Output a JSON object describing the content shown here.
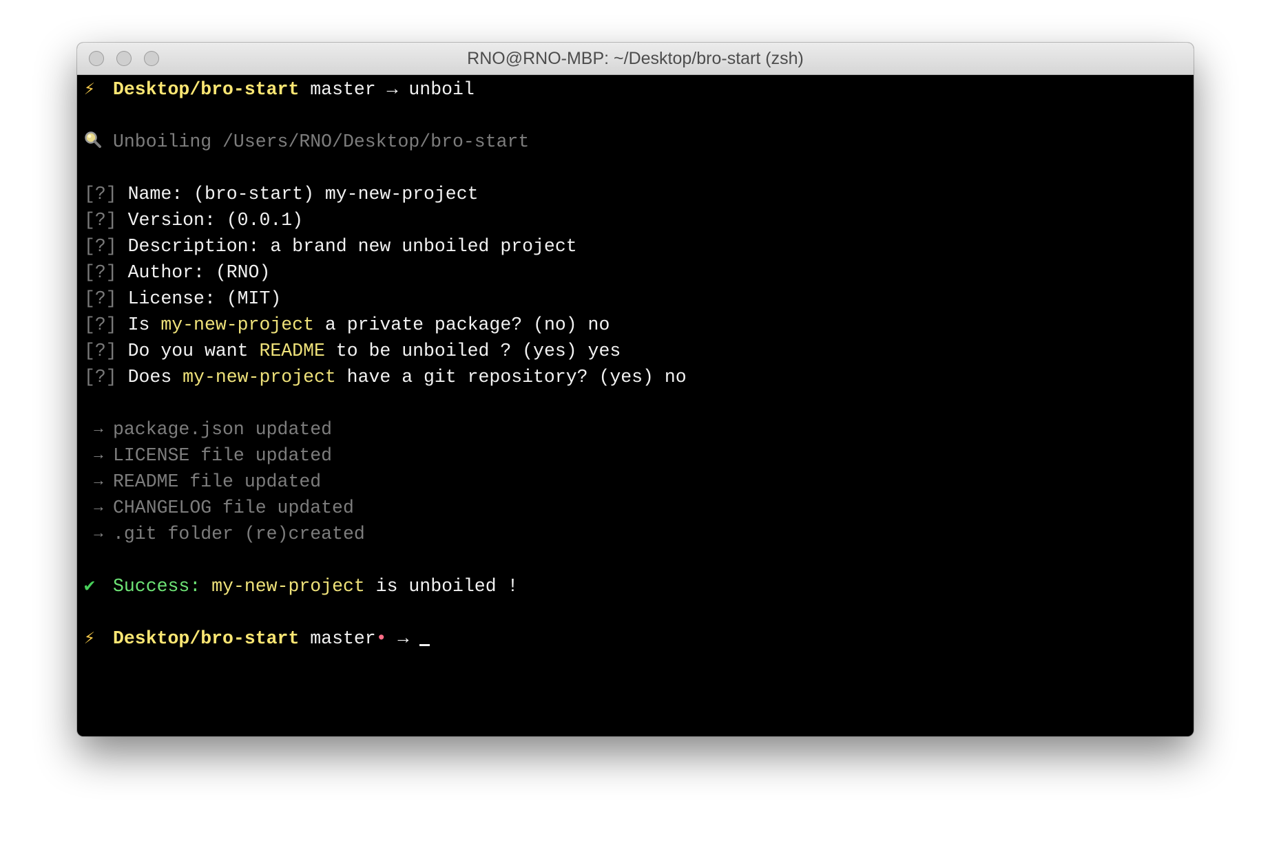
{
  "window": {
    "title": "RNO@RNO-MBP: ~/Desktop/bro-start (zsh)"
  },
  "colors": {
    "terminal_bg": "#000000",
    "path_yellow": "#fbe673",
    "highlight_yellow": "#efe27a",
    "dim_gray": "#7d7d7d",
    "success_green": "#6ee476",
    "dirty_dot_pink": "#ff6e87"
  },
  "prompt1": {
    "icon": "lightning-bolt-icon",
    "bolt": "⚡",
    "path": "Desktop/bro-start",
    "branch": "master",
    "arrow": "→",
    "command": "unboil"
  },
  "unboiling": {
    "icon": "magnifying-glass-icon",
    "text": "Unboiling /Users/RNO/Desktop/bro-start"
  },
  "questions": [
    {
      "marker": "[?]",
      "parts": [
        {
          "text": "Name: (bro-start) my-new-project",
          "hl": false
        }
      ]
    },
    {
      "marker": "[?]",
      "parts": [
        {
          "text": "Version: (0.0.1)",
          "hl": false
        }
      ]
    },
    {
      "marker": "[?]",
      "parts": [
        {
          "text": "Description: a brand new unboiled project",
          "hl": false
        }
      ]
    },
    {
      "marker": "[?]",
      "parts": [
        {
          "text": "Author: (RNO)",
          "hl": false
        }
      ]
    },
    {
      "marker": "[?]",
      "parts": [
        {
          "text": "License: (MIT)",
          "hl": false
        }
      ]
    },
    {
      "marker": "[?]",
      "parts": [
        {
          "text": "Is ",
          "hl": false
        },
        {
          "text": "my-new-project",
          "hl": true
        },
        {
          "text": " a private package? (no) no",
          "hl": false
        }
      ]
    },
    {
      "marker": "[?]",
      "parts": [
        {
          "text": "Do you want ",
          "hl": false
        },
        {
          "text": "README",
          "hl": true
        },
        {
          "text": " to be unboiled ? (yes) yes",
          "hl": false
        }
      ]
    },
    {
      "marker": "[?]",
      "parts": [
        {
          "text": "Does ",
          "hl": false
        },
        {
          "text": "my-new-project",
          "hl": true
        },
        {
          "text": " have a git repository? (yes) no",
          "hl": false
        }
      ]
    }
  ],
  "updates": [
    {
      "arrow": "→",
      "text": "package.json updated"
    },
    {
      "arrow": "→",
      "text": "LICENSE file updated"
    },
    {
      "arrow": "→",
      "text": "README file updated"
    },
    {
      "arrow": "→",
      "text": "CHANGELOG file updated"
    },
    {
      "arrow": "→",
      "text": ".git folder (re)created"
    }
  ],
  "success": {
    "icon": "checkmark-icon",
    "check": "✔",
    "label": "Success:",
    "project": "my-new-project",
    "rest": " is unboiled !"
  },
  "prompt2": {
    "icon": "lightning-bolt-icon",
    "bolt": "⚡",
    "path": "Desktop/bro-start",
    "branch": "master",
    "dirty": "•",
    "arrow": "→"
  }
}
